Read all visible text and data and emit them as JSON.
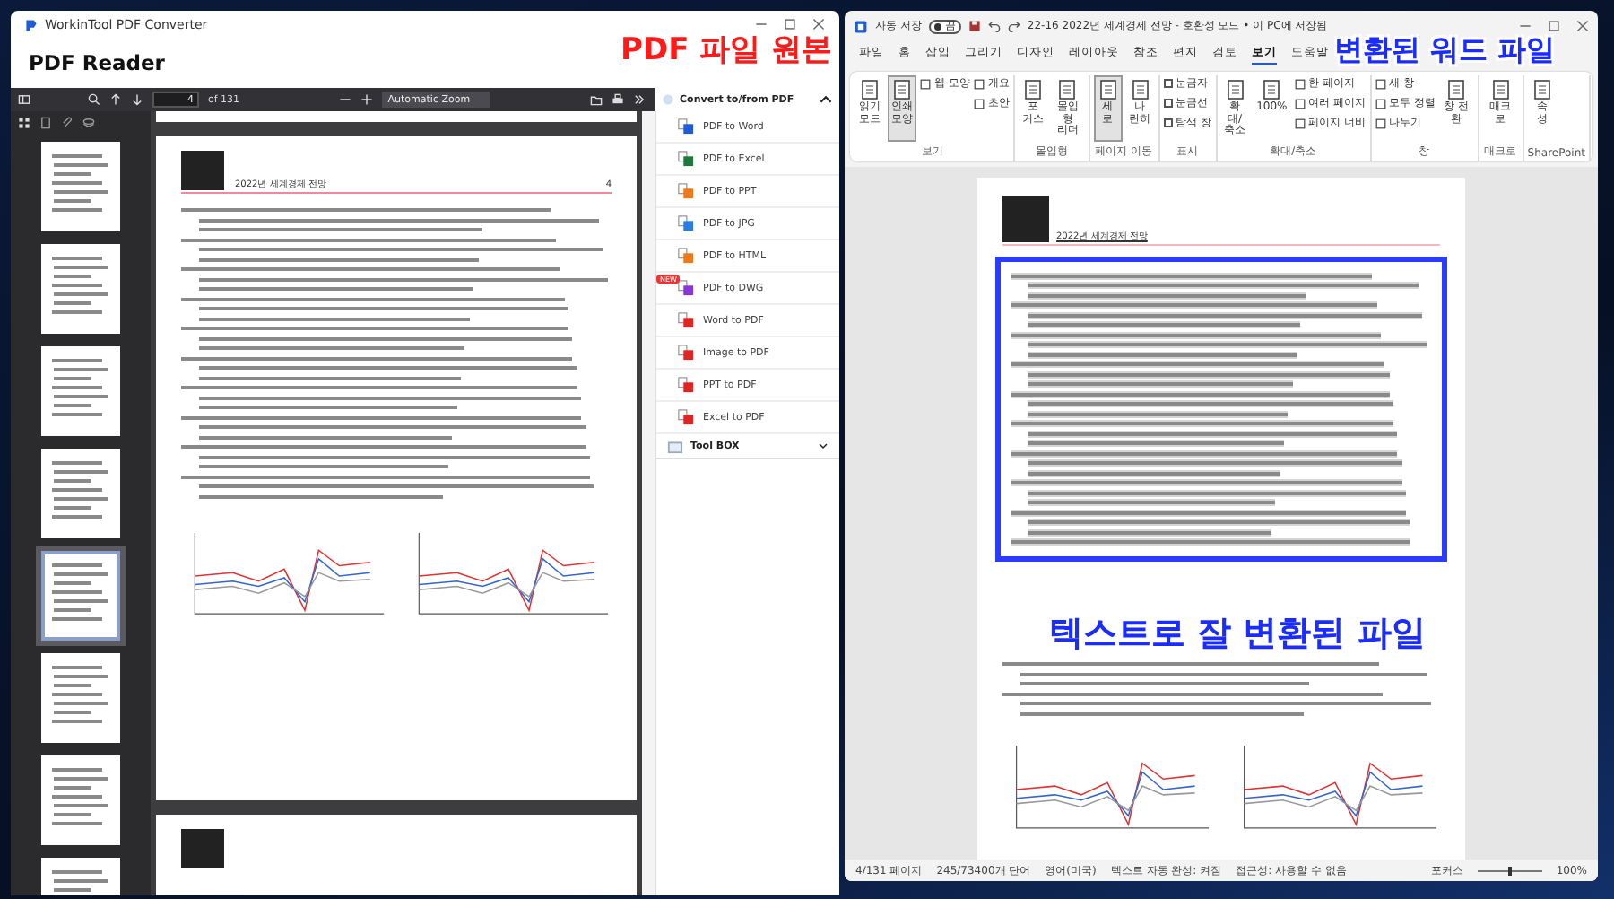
{
  "left_window": {
    "app_title": "WorkinTool PDF Converter",
    "heading": "PDF Reader",
    "toolbar": {
      "page": "4",
      "page_count": "of 131",
      "zoom": "Automatic Zoom"
    },
    "thumbnails": [
      {
        "selected": false
      },
      {
        "selected": false
      },
      {
        "selected": false
      },
      {
        "selected": false
      },
      {
        "selected": true
      },
      {
        "selected": false
      },
      {
        "selected": false
      },
      {
        "selected": false
      }
    ],
    "page": {
      "header": "2022년 세계경제 전망",
      "page_number": "4"
    },
    "panel": {
      "title": "Convert to/from PDF",
      "expanded": true,
      "items": [
        {
          "label": "PDF to Word",
          "color": "#1f5bd6"
        },
        {
          "label": "PDF to Excel",
          "color": "#1d7a3a"
        },
        {
          "label": "PDF to PPT",
          "color": "#f07a1a"
        },
        {
          "label": "PDF to JPG",
          "color": "#2a7de1"
        },
        {
          "label": "PDF to HTML",
          "color": "#f07a1a"
        },
        {
          "label": "PDF to DWG",
          "color": "#8a35d8",
          "badge": "NEW"
        },
        {
          "label": "Word to PDF",
          "color": "#e02424"
        },
        {
          "label": "Image to PDF",
          "color": "#e02424"
        },
        {
          "label": "PPT to PDF",
          "color": "#e02424"
        },
        {
          "label": "Excel to PDF",
          "color": "#e02424"
        }
      ],
      "toolbox": {
        "title": "Tool BOX",
        "expanded": false
      }
    }
  },
  "right_window": {
    "autosave_label": "자동 저장",
    "autosave": {
      "on": false,
      "text": "끔"
    },
    "title": "22-16 2022년 세계경제 전망 - 호환성 모드 • 이 PC에 저장됨",
    "tabs": [
      {
        "label": "파일",
        "selected": false
      },
      {
        "label": "홈",
        "selected": false
      },
      {
        "label": "삽입",
        "selected": false
      },
      {
        "label": "그리기",
        "selected": false
      },
      {
        "label": "디자인",
        "selected": false
      },
      {
        "label": "레이아웃",
        "selected": false
      },
      {
        "label": "참조",
        "selected": false
      },
      {
        "label": "편지",
        "selected": false
      },
      {
        "label": "검토",
        "selected": false
      },
      {
        "label": "보기",
        "selected": true
      },
      {
        "label": "도움말",
        "selected": false
      }
    ],
    "groups": [
      {
        "name": "보기",
        "items": [
          {
            "kind": "large",
            "label": "읽기\n모드",
            "selected": false
          },
          {
            "kind": "large",
            "label": "인쇄\n모양",
            "selected": true
          },
          {
            "kind": "stack",
            "items": [
              {
                "kind": "small",
                "label": "웹 모양"
              }
            ]
          },
          {
            "kind": "stack",
            "items": [
              {
                "kind": "small",
                "label": "개요"
              },
              {
                "kind": "small",
                "label": "초안"
              }
            ]
          }
        ]
      },
      {
        "name": "몰입형",
        "items": [
          {
            "kind": "large",
            "label": "포\n커스",
            "selected": false
          },
          {
            "kind": "large",
            "label": "몰입형\n리더",
            "selected": false
          }
        ]
      },
      {
        "name": "페이지 이동",
        "items": [
          {
            "kind": "large",
            "label": "세\n로",
            "selected": true
          },
          {
            "kind": "large",
            "label": "나\n란히",
            "selected": false
          }
        ]
      },
      {
        "name": "표시",
        "items": [
          {
            "kind": "stack",
            "items": [
              {
                "kind": "check",
                "label": "눈금자",
                "checked": false
              },
              {
                "kind": "check",
                "label": "눈금선",
                "checked": false
              },
              {
                "kind": "check",
                "label": "탐색 창",
                "checked": false
              }
            ]
          }
        ]
      },
      {
        "name": "확대/축소",
        "items": [
          {
            "kind": "large",
            "label": "확대/\n축소",
            "selected": false
          },
          {
            "kind": "large",
            "label": "100%",
            "selected": false
          },
          {
            "kind": "stack",
            "items": [
              {
                "kind": "small",
                "label": "한 페이지"
              },
              {
                "kind": "small",
                "label": "여러 페이지"
              },
              {
                "kind": "small",
                "label": "페이지 너비"
              }
            ]
          }
        ]
      },
      {
        "name": "창",
        "items": [
          {
            "kind": "stack",
            "items": [
              {
                "kind": "small",
                "label": "새 창"
              },
              {
                "kind": "small",
                "label": "모두 정렬"
              },
              {
                "kind": "small",
                "label": "나누기"
              }
            ]
          },
          {
            "kind": "large",
            "label": "창 전환",
            "selected": false
          }
        ]
      },
      {
        "name": "매크로",
        "items": [
          {
            "kind": "large",
            "label": "매크로",
            "selected": false
          }
        ]
      },
      {
        "name": "SharePoint",
        "items": [
          {
            "kind": "large",
            "label": "속\n성",
            "selected": false
          }
        ]
      }
    ],
    "page": {
      "header": "2022년 세계경제 전망"
    },
    "status_bar": {
      "items": [
        "4/131 페이지",
        "245/73400개 단어",
        "영어(미국)",
        "텍스트 자동 완성: 켜짐",
        "접근성: 사용할 수 없음"
      ],
      "focus": "포커스",
      "zoom_slider": {
        "level": 0.5
      },
      "zoom": "100%"
    }
  },
  "annotations": [
    {
      "text": "PDF 파일 원본",
      "color": "#ff1a1a"
    },
    {
      "text": "변환된 워드 파일",
      "color": "#1a2cff"
    },
    {
      "text": "텍스트로 잘 변환된 파일",
      "color": "#1a2cff"
    }
  ]
}
